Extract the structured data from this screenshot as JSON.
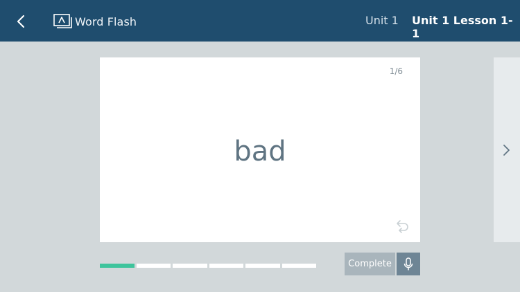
{
  "header": {
    "back_icon": "chevron-left-icon",
    "app_icon": "flashcard-icon",
    "title": "Word Flash",
    "unit": "Unit 1",
    "lesson": "Unit 1 Lesson 1-1"
  },
  "card": {
    "counter": "1/6",
    "word": "bad",
    "flip_icon": "undo-rotate-icon"
  },
  "navigation": {
    "next_icon": "chevron-right-icon"
  },
  "progress": {
    "total": 6,
    "current": 1
  },
  "actions": {
    "complete_label": "Complete",
    "mic_icon": "microphone-icon"
  },
  "colors": {
    "header_bg": "#1f4d6e",
    "page_bg": "#d2d8da",
    "progress_active": "#3ec49c",
    "word_text": "#5f7482"
  }
}
